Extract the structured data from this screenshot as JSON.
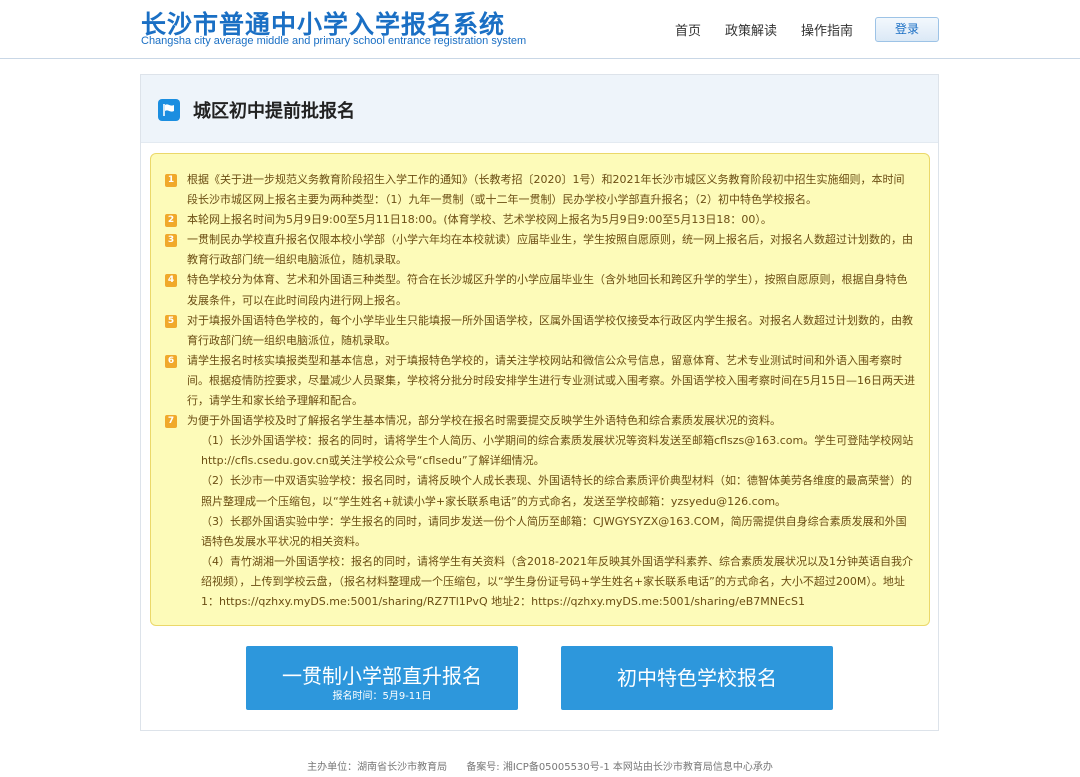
{
  "header": {
    "title": "长沙市普通中小学入学报名系统",
    "subtitle": "Changsha city average middle and primary school entrance registration system",
    "nav": [
      "首页",
      "政策解读",
      "操作指南"
    ],
    "login_label": "登录"
  },
  "panel": {
    "icon": "flag-icon",
    "title": "城区初中提前批报名"
  },
  "notices": [
    {
      "num": "1",
      "text": "根据《关于进一步规范义务教育阶段招生入学工作的通知》（长教考招〔2020〕1号）和2021年长沙市城区义务教育阶段初中招生实施细则，本时间段长沙市城区网上报名主要为两种类型：（1）九年一贯制（或十二年一贯制）民办学校小学部直升报名；（2）初中特色学校报名。"
    },
    {
      "num": "2",
      "text": "本轮网上报名时间为5月9日9:00至5月11日18:00。(体育学校、艺术学校网上报名为5月9日9:00至5月13日18：00）。"
    },
    {
      "num": "3",
      "text": "一贯制民办学校直升报名仅限本校小学部（小学六年均在本校就读）应届毕业生，学生按照自愿原则，统一网上报名后，对报名人数超过计划数的，由教育行政部门统一组织电脑派位，随机录取。"
    },
    {
      "num": "4",
      "text": "特色学校分为体育、艺术和外国语三种类型。符合在长沙城区升学的小学应届毕业生（含外地回长和跨区升学的学生），按照自愿原则，根据自身特色发展条件，可以在此时间段内进行网上报名。"
    },
    {
      "num": "5",
      "text": "对于填报外国语特色学校的，每个小学毕业生只能填报一所外国语学校，区属外国语学校仅接受本行政区内学生报名。对报名人数超过计划数的，由教育行政部门统一组织电脑派位，随机录取。"
    },
    {
      "num": "6",
      "text": "请学生报名时核实填报类型和基本信息，对于填报特色学校的，请关注学校网站和微信公众号信息，留意体育、艺术专业测试时间和外语入围考察时间。根据疫情防控要求，尽量减少人员聚集，学校将分批分时段安排学生进行专业测试或入围考察。外国语学校入围考察时间在5月15日—16日两天进行，请学生和家长给予理解和配合。"
    },
    {
      "num": "7",
      "text": "为便于外国语学校及时了解报名学生基本情况，部分学校在报名时需要提交反映学生外语特色和综合素质发展状况的资料。"
    }
  ],
  "sub_notices": [
    "（1）长沙外国语学校：报名的同时，请将学生个人简历、小学期间的综合素质发展状况等资料发送至邮箱cflszs@163.com。学生可登陆学校网站http://cfls.csedu.gov.cn或关注学校公众号“cflsedu”了解详细情况。",
    "（2）长沙市一中双语实验学校：报名同时，请将反映个人成长表现、外国语特长的综合素质评价典型材料（如：德智体美劳各维度的最高荣誉）的照片整理成一个压缩包，以“学生姓名+就读小学+家长联系电话”的方式命名，发送至学校邮箱：yzsyedu@126.com。",
    "（3）长郡外国语实验中学：学生报名的同时，请同步发送一份个人简历至邮箱：CJWGYSYZX@163.COM，简历需提供自身综合素质发展和外国语特色发展水平状况的相关资料。",
    "（4）青竹湖湘一外国语学校：报名的同时，请将学生有关资料（含2018-2021年反映其外国语学科素养、综合素质发展状况以及1分钟英语自我介绍视频），上传到学校云盘，（报名材料整理成一个压缩包，以“学生身份证号码+学生姓名+家长联系电话”的方式命名，大小不超过200M）。地址1：https://qzhxy.myDS.me:5001/sharing/RZ7Tl1PvQ 地址2：https://qzhxy.myDS.me:5001/sharing/eB7MNEcS1"
  ],
  "buttons": {
    "direct": {
      "label": "一贯制小学部直升报名",
      "sub": "报名时间：5月9-11日"
    },
    "special": {
      "label": "初中特色学校报名"
    }
  },
  "footer": {
    "sponsor": "主办单位：湖南省长沙市教育局",
    "icp": "备案号: 湘ICP备05005530号-1 本网站由长沙市教育局信息中心承办"
  },
  "colors": {
    "brand": "#1a6fc4",
    "button": "#2d97dc",
    "notice_bg": "#fdfbb9",
    "badge": "#f0a92b"
  }
}
